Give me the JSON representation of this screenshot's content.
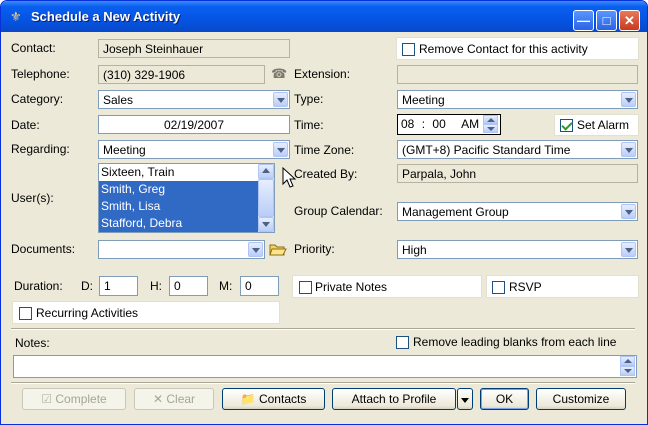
{
  "window": {
    "title": "Schedule a New Activity"
  },
  "labels": {
    "contact": "Contact:",
    "telephone": "Telephone:",
    "category": "Category:",
    "date": "Date:",
    "regarding": "Regarding:",
    "users": "User(s):",
    "documents": "Documents:",
    "duration": "Duration:",
    "d": "D:",
    "h": "H:",
    "m": "M:",
    "extension": "Extension:",
    "type": "Type:",
    "time": "Time:",
    "time_zone": "Time Zone:",
    "created_by": "Created By:",
    "group_calendar": "Group Calendar:",
    "priority": "Priority:",
    "notes": "Notes:"
  },
  "values": {
    "contact": "Joseph Steinhauer",
    "telephone": "(310) 329-1906",
    "category": "Sales",
    "date": "02/19/2007",
    "regarding": "Meeting",
    "documents": "",
    "extension": "",
    "type": "Meeting",
    "time_hour": "08",
    "time_sep": ":",
    "time_min": "00",
    "time_ampm": "AM",
    "time_zone": "(GMT+8) Pacific Standard Time",
    "created_by": "Parpala, John",
    "group_calendar": "Management Group",
    "priority": "High",
    "duration_d": "1",
    "duration_h": "0",
    "duration_m": "0",
    "notes": ""
  },
  "users_list": [
    {
      "name": "Sixteen, Train",
      "selected": false
    },
    {
      "name": "Smith, Greg",
      "selected": true
    },
    {
      "name": "Smith, Lisa",
      "selected": true
    },
    {
      "name": "Stafford, Debra",
      "selected": true
    }
  ],
  "checkboxes": {
    "remove_contact": {
      "label": "Remove Contact for this activity",
      "checked": false
    },
    "set_alarm": {
      "label": "Set Alarm",
      "checked": true
    },
    "private_notes": {
      "label": "Private Notes",
      "checked": false
    },
    "rsvp": {
      "label": "RSVP",
      "checked": false
    },
    "recurring": {
      "label": "Recurring Activities",
      "checked": false
    },
    "remove_blanks": {
      "label": "Remove leading blanks from each line",
      "checked": false
    }
  },
  "buttons": {
    "complete": "Complete",
    "clear": "Clear",
    "contacts": "Contacts",
    "attach": "Attach to Profile",
    "ok": "OK",
    "customize": "Customize"
  },
  "colors": {
    "title_blue": "#0554e3",
    "selection": "#316ac5",
    "face": "#ece9d8"
  }
}
